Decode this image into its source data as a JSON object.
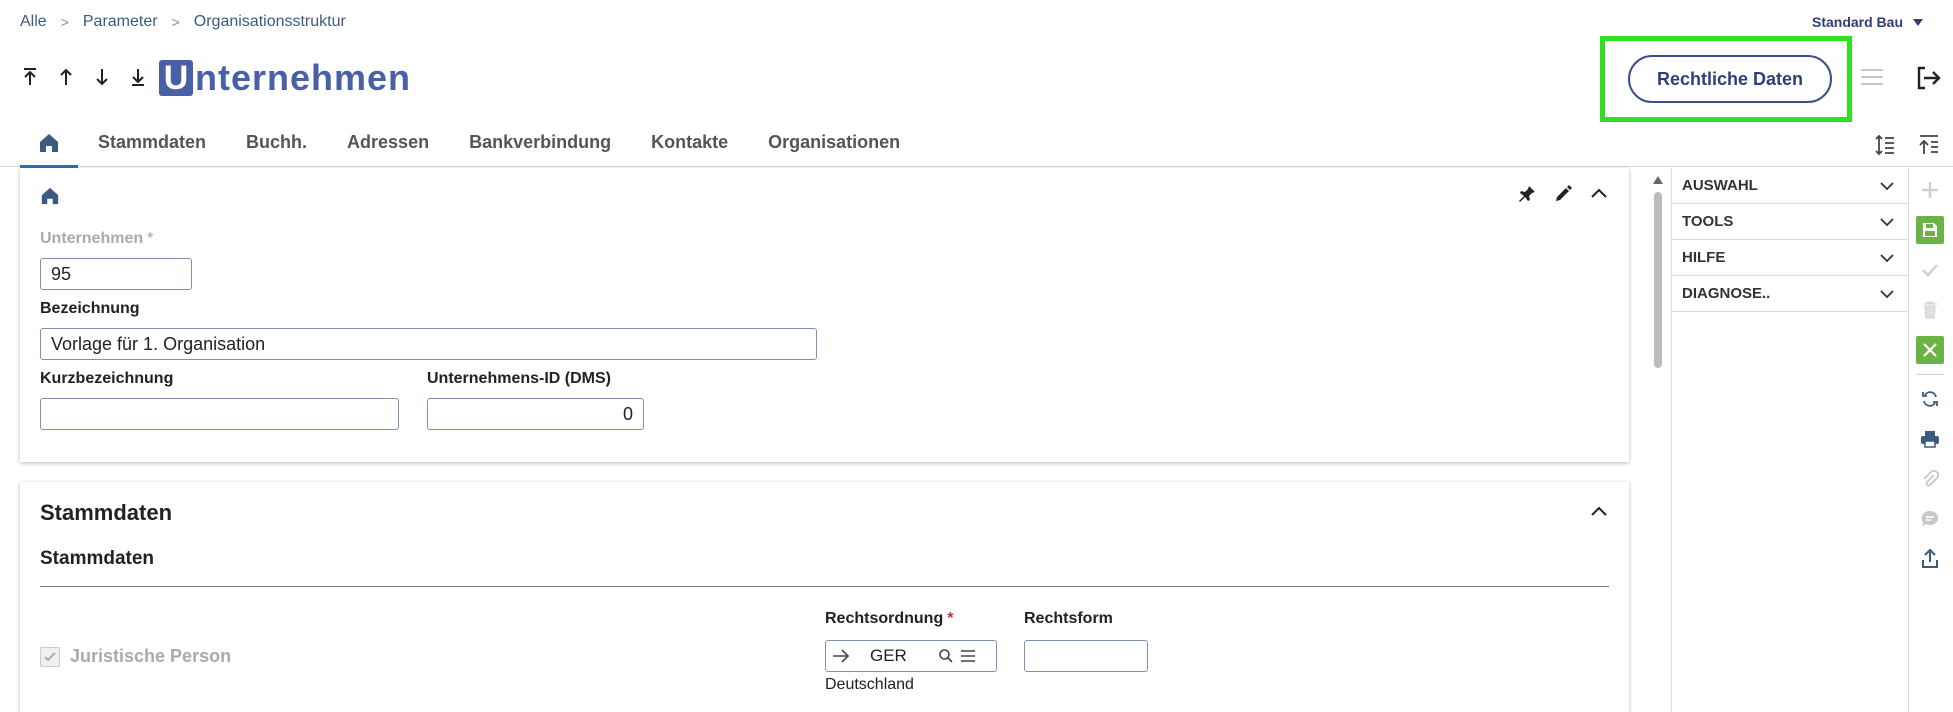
{
  "breadcrumb": {
    "items": [
      "Alle",
      "Parameter",
      "Organisationsstruktur"
    ]
  },
  "company_selector": {
    "label": "Standard Bau"
  },
  "logo": {
    "letter": "U",
    "text": "nternehmen"
  },
  "header": {
    "legal_button": "Rechtliche Daten"
  },
  "tabs": [
    "Stammdaten",
    "Buchh.",
    "Adressen",
    "Bankverbindung",
    "Kontakte",
    "Organisationen"
  ],
  "header_card": {
    "fields": {
      "unternehmen": {
        "label": "Unternehmen",
        "value": "95"
      },
      "bezeichnung": {
        "label": "Bezeichnung",
        "value": "Vorlage für 1. Organisation"
      },
      "kurzbezeichnung": {
        "label": "Kurzbezeichnung",
        "value": ""
      },
      "unternehmens_id": {
        "label": "Unternehmens-ID (DMS)",
        "value": "0"
      }
    }
  },
  "stammdaten": {
    "title": "Stammdaten",
    "subtitle": "Stammdaten",
    "juristische_person": {
      "label": "Juristische Person",
      "checked": true
    },
    "rechtsordnung": {
      "label": "Rechtsordnung",
      "value": "GER",
      "description": "Deutschland"
    },
    "rechtsform": {
      "label": "Rechtsform",
      "value": ""
    }
  },
  "side_panel": {
    "sections": [
      "AUSWAHL",
      "TOOLS",
      "HILFE",
      "DIAGNOSE.."
    ]
  },
  "colors": {
    "brand": "#4860a5",
    "highlight": "#2fe01e",
    "accent_green": "#6bb347",
    "required": "#c03030"
  }
}
